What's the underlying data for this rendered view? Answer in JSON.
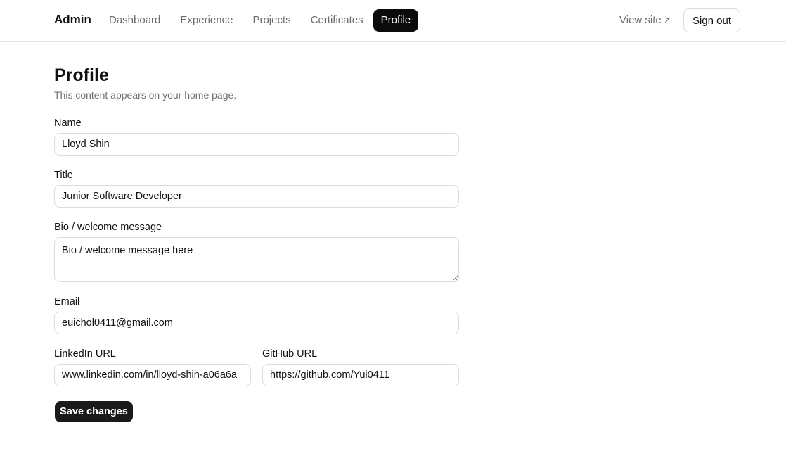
{
  "header": {
    "brand": "Admin",
    "nav": [
      {
        "label": "Dashboard"
      },
      {
        "label": "Experience"
      },
      {
        "label": "Projects"
      },
      {
        "label": "Certificates"
      },
      {
        "label": "Profile"
      }
    ],
    "active_nav": "Profile",
    "view_site_label": "View site",
    "sign_out_label": "Sign out"
  },
  "page": {
    "title": "Profile",
    "subtitle": "This content appears on your home page."
  },
  "form": {
    "name": {
      "label": "Name",
      "value": "Lloyd Shin"
    },
    "title": {
      "label": "Title",
      "value": "Junior Software Developer"
    },
    "bio": {
      "label": "Bio / welcome message",
      "value": "Bio / welcome message here"
    },
    "email": {
      "label": "Email",
      "value": "euichol0411@gmail.com"
    },
    "linkedin": {
      "label": "LinkedIn URL",
      "value": "www.linkedin.com/in/lloyd-shin-a06a6a"
    },
    "github": {
      "label": "GitHub URL",
      "value": "https://github.com/Yui0411"
    },
    "save_label": "Save changes"
  },
  "colors": {
    "active_nav_bg": "#0b0b0b",
    "primary_button_bg": "#1a1a1a",
    "muted_text": "#6b6b6b",
    "border": "#dcdcdc"
  }
}
